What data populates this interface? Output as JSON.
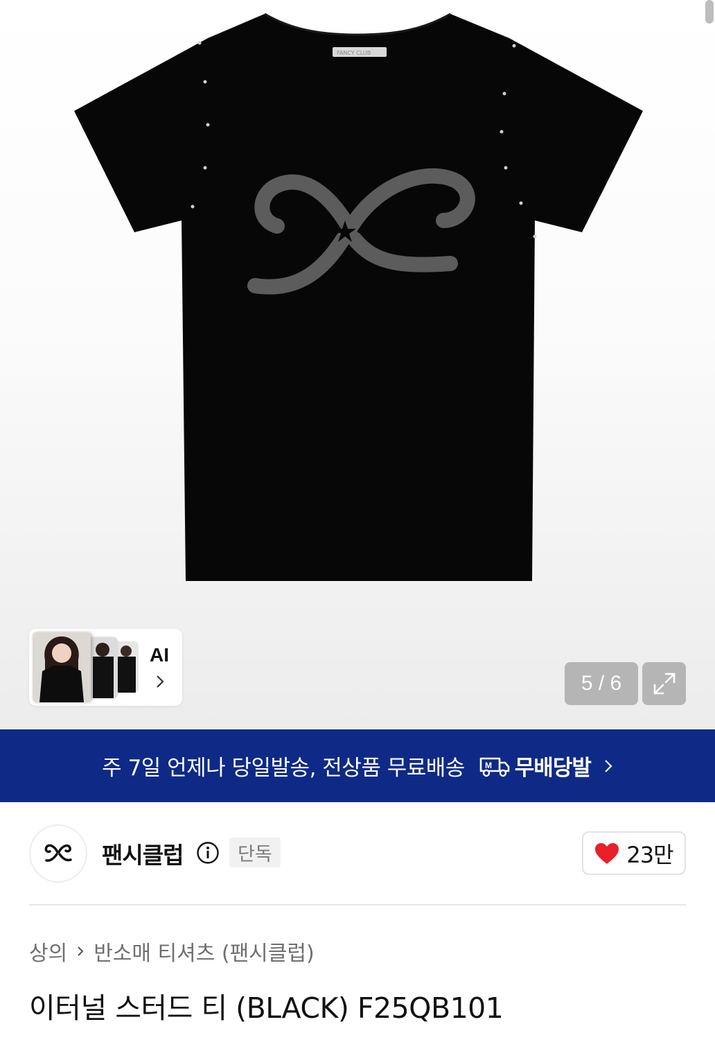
{
  "gallery": {
    "counter": "5 / 6",
    "ai_label": "AI",
    "shirt_tag_text": "FANCY CLUB",
    "icons": [
      "expand-icon",
      "chevron-right-icon"
    ]
  },
  "banner": {
    "message": "주 7일 언제나 당일발송, 전상품 무료배송",
    "badge_text": "무배당발",
    "badge_icon": "delivery-truck-icon",
    "colors": {
      "background": "#0e2a86",
      "text": "#ffffff"
    }
  },
  "brand": {
    "name": "팬시클럽",
    "tag": "단독",
    "likes": "23만",
    "colors": {
      "heart": "#e8202a"
    }
  },
  "breadcrumb": {
    "level1": "상의",
    "level2": "반소매 티셔츠 (팬시클럽)"
  },
  "product": {
    "title": "이터널 스터드 티 (BLACK) F25QB101"
  }
}
